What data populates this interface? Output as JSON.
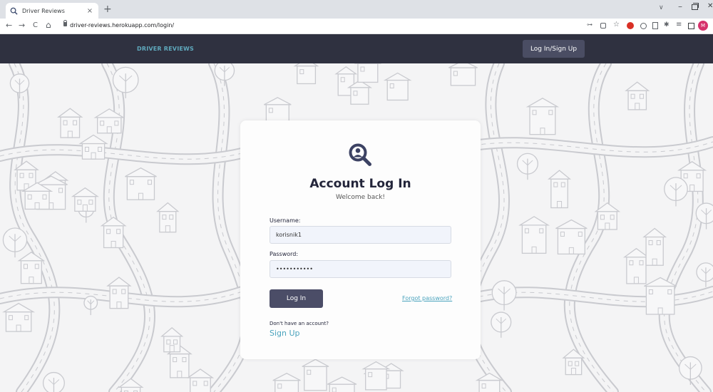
{
  "browser": {
    "tab_title": "Driver Reviews",
    "tab_close": "×",
    "new_tab": "+",
    "tab_search": "∨",
    "window_minimize": "–",
    "window_close": "✕",
    "back": "←",
    "forward": "→",
    "reload": "C",
    "home": "⌂",
    "url": "driver-reviews.herokuapp.com/login/",
    "key_icon": "⊶",
    "star_icon": "☆",
    "puzzle_icon": "✱",
    "list_icon": "≡",
    "profile_initial": "M"
  },
  "nav": {
    "brand": "DRIVER REVIEWS",
    "login_signup": "Log In/Sign Up"
  },
  "card": {
    "title": "Account Log In",
    "subtitle": "Welcome back!",
    "username_label": "Username:",
    "username_value": "korisnik1",
    "password_label": "Password:",
    "password_value": "lozinka1234",
    "login_button": "Log In",
    "forgot_password": "Forgot password?",
    "no_account": "Don't have an account?",
    "signup": "Sign Up"
  },
  "colors": {
    "navbar": "#2f3140",
    "brand": "#5fa9bd",
    "primary_button": "#4b4d67",
    "link": "#4aa3bd",
    "input_bg": "#f1f4fb"
  }
}
